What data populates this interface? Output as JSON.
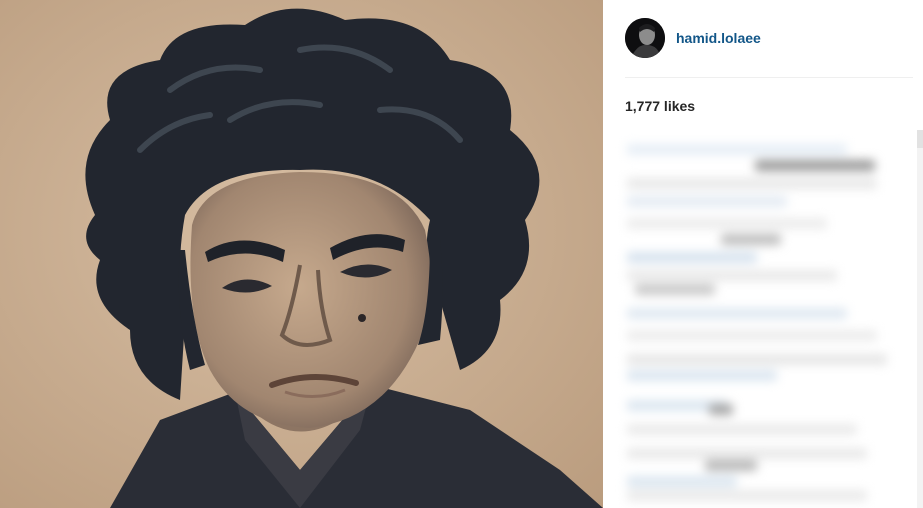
{
  "post": {
    "username": "hamid.lolaee",
    "likes_text": "1,777 likes"
  },
  "colors": {
    "username_link": "#125688",
    "likes_text": "#262626",
    "photo_background": "#cdb195",
    "hair": "#22262f"
  },
  "icons": {
    "avatar": "profile-avatar"
  }
}
